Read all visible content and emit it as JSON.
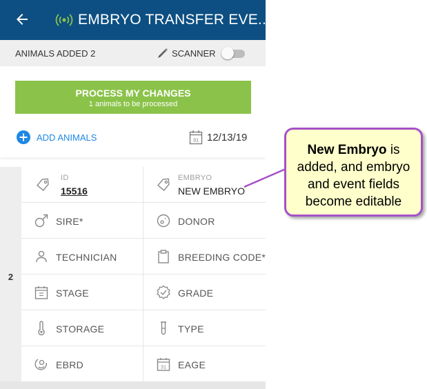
{
  "appbar": {
    "title": "EMBRYO TRANSFER EVE...",
    "back_icon": "arrow-left-icon",
    "rfid_icon": "rfid-signal-icon",
    "rfid_color": "#8bc34a",
    "bg_color": "#0d4f82"
  },
  "infobar": {
    "animals_added_label": "ANIMALS ADDED",
    "animals_added_count": "2",
    "scanner_label": "SCANNER",
    "scanner_icon": "scanner-pen-icon",
    "scanner_enabled": false
  },
  "process": {
    "title": "PROCESS MY CHANGES",
    "subtitle": "1 animals to be processed",
    "color": "#8bc34a"
  },
  "add_animals": {
    "label": "ADD ANIMALS",
    "icon": "plus-circle-icon",
    "color": "#1e88e5"
  },
  "date": {
    "icon": "calendar-icon",
    "value": "12/13/19"
  },
  "animal_row": {
    "index": "2",
    "id": {
      "label": "ID",
      "value": "15516",
      "icon": "tag-icon"
    },
    "embryo": {
      "label": "EMBRYO",
      "value": "NEW EMBRYO",
      "icon": "tag-icon"
    },
    "fields": [
      {
        "left": {
          "label": "SIRE*",
          "icon": "male-symbol-icon"
        },
        "right": {
          "label": "DONOR",
          "icon": "egg-cell-icon"
        }
      },
      {
        "left": {
          "label": "TECHNICIAN",
          "icon": "person-icon"
        },
        "right": {
          "label": "BREEDING CODE*",
          "icon": "clipboard-icon"
        }
      },
      {
        "left": {
          "label": "STAGE",
          "icon": "calendar-stage-icon"
        },
        "right": {
          "label": "GRADE",
          "icon": "badge-check-icon"
        }
      },
      {
        "left": {
          "label": "STORAGE",
          "icon": "thermometer-icon"
        },
        "right": {
          "label": "TYPE",
          "icon": "test-tube-icon"
        }
      },
      {
        "left": {
          "label": "EBRD",
          "icon": "embryo-icon"
        },
        "right": {
          "label": "EAGE",
          "icon": "calendar-icon"
        }
      }
    ]
  },
  "callout": {
    "bold": "New Embryo",
    "line1_rest": " is",
    "line2": "added, and embryo",
    "line3": "and event fields",
    "line4": "become editable",
    "border_color": "#a650c9",
    "bg_color": "#ffffcc"
  }
}
